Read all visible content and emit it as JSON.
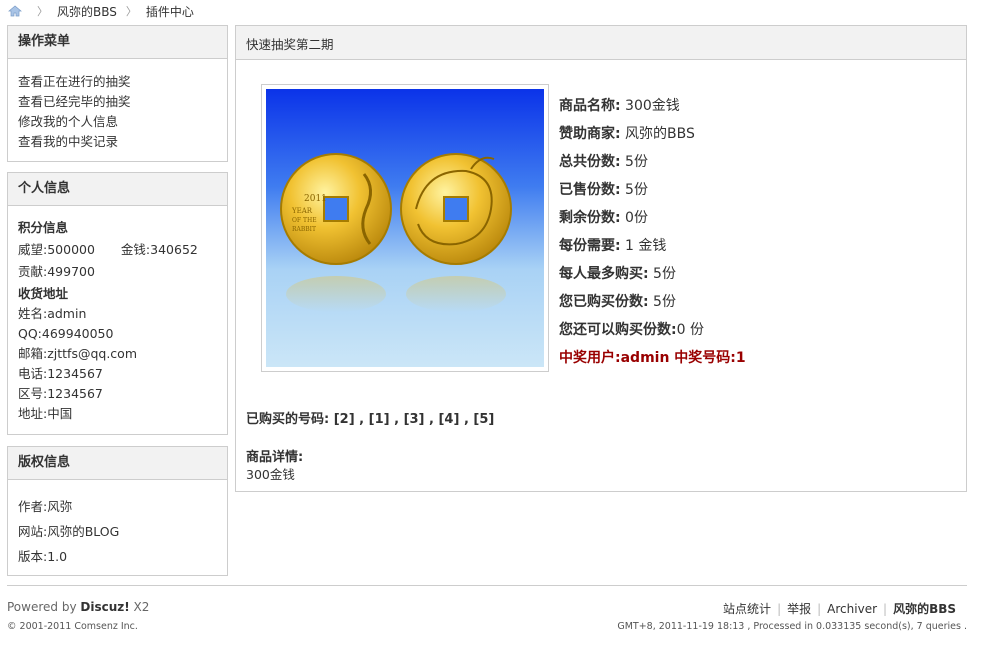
{
  "breadcrumb": {
    "home_icon": "home-icon",
    "site": "风弥的BBS",
    "section": "插件中心"
  },
  "sidebar": {
    "menu": {
      "title": "操作菜单",
      "items": [
        "查看正在进行的抽奖",
        "查看已经完毕的抽奖",
        "修改我的个人信息",
        "查看我的中奖记录"
      ]
    },
    "personal": {
      "title": "个人信息",
      "points_title": "积分信息",
      "prestige": "威望:500000",
      "gold": "金钱:340652",
      "contribution": "贡献:499700",
      "address_title": "收货地址",
      "name": "姓名:admin",
      "qq": "QQ:469940050",
      "email": "邮箱:zjttfs@qq.com",
      "phone": "电话:1234567",
      "area_code": "区号:1234567",
      "address": "地址:中国"
    },
    "copyright": {
      "title": "版权信息",
      "author": "作者:风弥",
      "website": "网站:风弥的BLOG",
      "version": "版本:1.0"
    }
  },
  "main": {
    "title": "快速抽奖第二期",
    "coin_text_left": "2011 YEAR OF THE RABBIT",
    "product": [
      {
        "label": "商品名称:",
        "value": " 300金钱"
      },
      {
        "label": "赞助商家:",
        "value": " 风弥的BBS"
      },
      {
        "label": "总共份数:",
        "value": " 5份"
      },
      {
        "label": "已售份数:",
        "value": " 5份"
      },
      {
        "label": "剩余份数:",
        "value": " 0份"
      },
      {
        "label": "每份需要:",
        "value": " 1 金钱"
      },
      {
        "label": "每人最多购买:",
        "value": " 5份"
      },
      {
        "label": "您已购买份数:",
        "value": " 5份"
      },
      {
        "label": "您还可以购买份数:",
        "value": "0 份"
      }
    ],
    "winner": "中奖用户:admin 中奖号码:1",
    "bought_numbers_label": "已购买的号码:",
    "bought_numbers": " [2] , [1] , [3] , [4] , [5]",
    "detail_title": "商品详情:",
    "detail_value": "300金钱"
  },
  "footer": {
    "powered_prefix": "Powered by ",
    "powered_brand": "Discuz!",
    "powered_version": " X2",
    "copyright": "© 2001-2011 Comsenz Inc.",
    "links": [
      "站点统计",
      "举报",
      "Archiver",
      "风弥的BBS"
    ],
    "gmt": "GMT+8, 2011-11-19 18:13 , Processed in 0.033135 second(s), 7 queries ."
  }
}
